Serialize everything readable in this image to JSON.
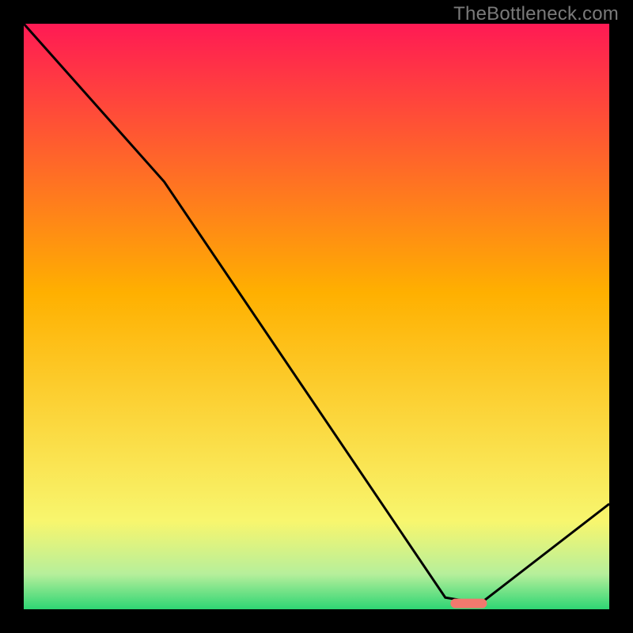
{
  "watermark": "TheBottleneck.com",
  "colors": {
    "frame": "#000000",
    "line": "#000000",
    "marker": "#f1796e",
    "gradient_top": "#ff1a54",
    "gradient_mid": "#ffb000",
    "gradient_low": "#f8f66e",
    "gradient_green_light": "#b6ef9b",
    "gradient_green": "#2ed573"
  },
  "chart_data": {
    "type": "line",
    "title": "",
    "xlabel": "",
    "ylabel": "",
    "xlim": [
      0,
      100
    ],
    "ylim": [
      0,
      100
    ],
    "x": [
      0,
      24,
      72,
      78,
      100
    ],
    "values": [
      100,
      73,
      2,
      1,
      18
    ],
    "minimum_marker": {
      "x": 76,
      "y": 1
    },
    "notes": "y is a qualitative mismatch metric read from a vertical color gradient (red=100 worst, green=0 best); x is an unlabeled horizontal position 0-100. Values estimated from pixel positions; chart has no numeric axes."
  }
}
